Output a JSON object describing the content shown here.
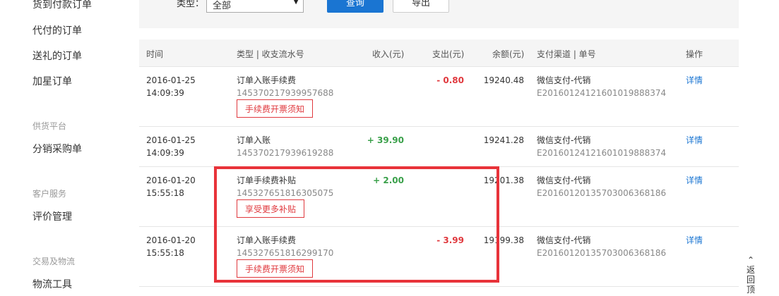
{
  "sidebar": {
    "items_top": [
      "货到付款订单",
      "代付的订单",
      "送礼的订单",
      "加星订单"
    ],
    "group_supply": "供货平台",
    "item_distribution": "分销采购单",
    "group_service": "客户服务",
    "item_review": "评价管理",
    "group_logistics": "交易及物流",
    "item_logistics": "物流工具"
  },
  "filter": {
    "type_label": "类型：",
    "type_value": "全部",
    "query_label": "查询",
    "export_label": "导出"
  },
  "table": {
    "headers": {
      "time": "时间",
      "type": "类型 | 收支流水号",
      "income": "收入(元)",
      "expense": "支出(元)",
      "balance": "余额(元)",
      "channel": "支付渠道 | 单号",
      "action": "操作"
    },
    "rows": [
      {
        "date": "2016-01-25",
        "clock": "14:09:39",
        "type": "订单入账手续费",
        "serial": "145370217939957688",
        "income": "",
        "expense": "- 0.80",
        "balance": "19240.48",
        "channel": "微信支付-代销",
        "order_no": "E20160124121601019888374",
        "action": "详情",
        "tag": "手续费开票须知"
      },
      {
        "date": "2016-01-25",
        "clock": "14:09:39",
        "type": "订单入账",
        "serial": "145370217939619288",
        "income": "+ 39.90",
        "expense": "",
        "balance": "19241.28",
        "channel": "微信支付-代销",
        "order_no": "E20160124121601019888374",
        "action": "详情",
        "tag": ""
      },
      {
        "date": "2016-01-20",
        "clock": "15:55:18",
        "type": "订单手续费补贴",
        "serial": "145327651816305075",
        "income": "+ 2.00",
        "expense": "",
        "balance": "19201.38",
        "channel": "微信支付-代销",
        "order_no": "E20160120135703006368186",
        "action": "详情",
        "tag": "享受更多补贴"
      },
      {
        "date": "2016-01-20",
        "clock": "15:55:18",
        "type": "订单入账手续费",
        "serial": "145327651816299170",
        "income": "",
        "expense": "- 3.99",
        "balance": "19199.38",
        "channel": "微信支付-代销",
        "order_no": "E20160120135703006368186",
        "action": "详情",
        "tag": "手续费开票须知"
      }
    ]
  },
  "back_to_top": {
    "line1": "返",
    "line2": "回",
    "line3": "顶"
  },
  "colors": {
    "accent": "#1a75d2",
    "income": "#3aa04a",
    "expense": "#e0393e",
    "highlight": "#e8333a"
  }
}
